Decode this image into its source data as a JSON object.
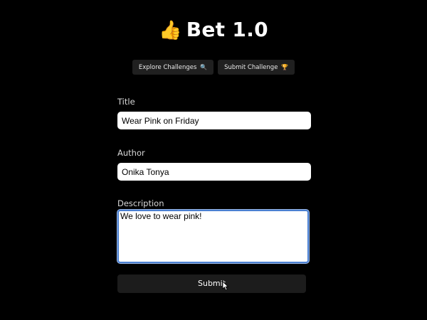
{
  "app": {
    "title_emoji": "👍",
    "title": "Bet 1.0"
  },
  "nav": {
    "explore_label": "Explore Challenges",
    "explore_icon": "🔍",
    "submit_label": "Submit Challenge",
    "submit_icon": "🏆"
  },
  "form": {
    "title_label": "Title",
    "title_value": "Wear Pink on Friday",
    "author_label": "Author",
    "author_value": "Onika Tonya",
    "description_label": "Description",
    "description_value": "We love to wear pink!",
    "submit_label": "Submit"
  },
  "colors": {
    "background": "#000000",
    "focus_ring": "#4a7fd0",
    "button_bg": "#1c1c1c"
  }
}
